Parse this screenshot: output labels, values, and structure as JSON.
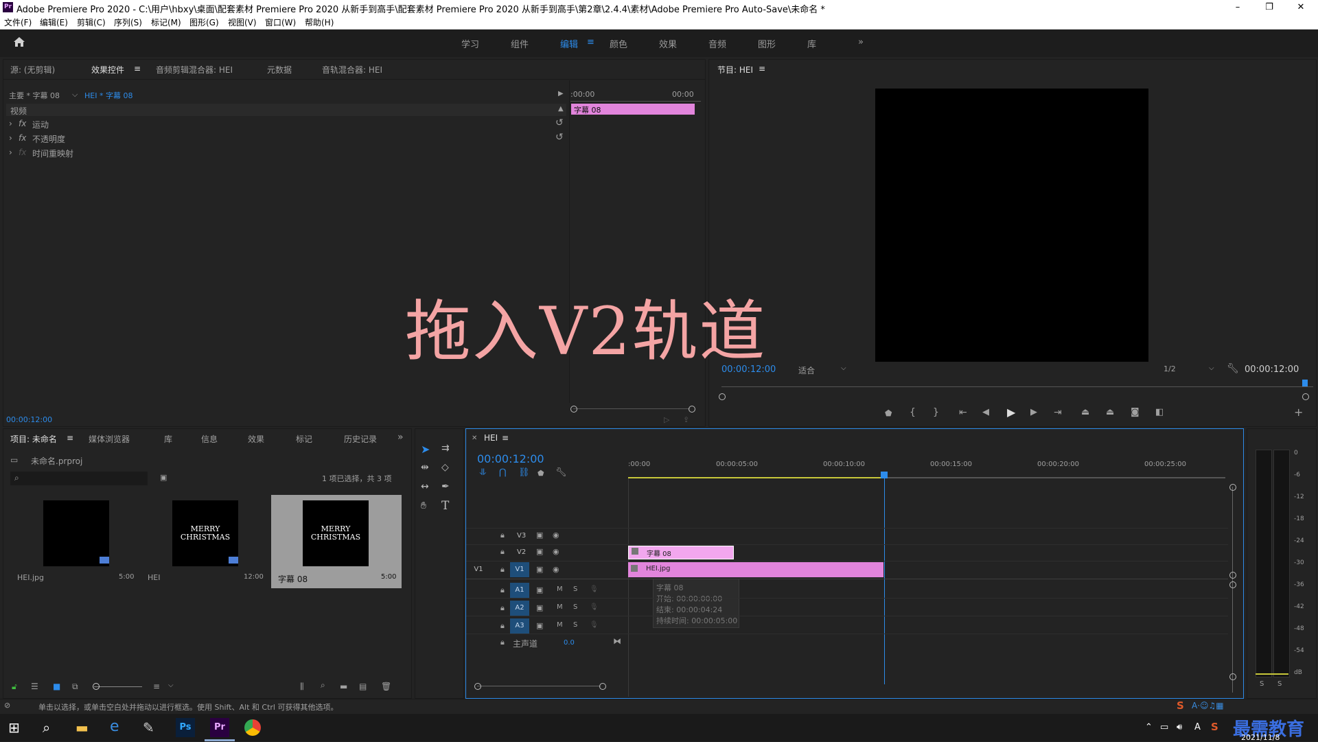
{
  "window": {
    "title": "Adobe Premiere Pro 2020 - C:\\用户\\hbxy\\桌面\\配套素材 Premiere Pro 2020 从新手到高手\\配套素材 Premiere Pro 2020 从新手到高手\\第2章\\2.4.4\\素材\\Adobe Premiere Pro Auto-Save\\未命名 *",
    "app_icon": "Pr",
    "controls": [
      "–",
      "❐",
      "✕"
    ]
  },
  "menu": [
    "文件(F)",
    "编辑(E)",
    "剪辑(C)",
    "序列(S)",
    "标记(M)",
    "图形(G)",
    "视图(V)",
    "窗口(W)",
    "帮助(H)"
  ],
  "workspaces": {
    "items": [
      "学习",
      "组件",
      "编辑",
      "颜色",
      "效果",
      "音频",
      "图形",
      "库"
    ],
    "active": "编辑",
    "more": "»"
  },
  "source_panel": {
    "tabs": [
      "源: (无剪辑)",
      "效果控件",
      "音频剪辑混合器: HEI",
      "元数据",
      "音轨混合器: HEI"
    ],
    "active_tab": "效果控件",
    "master_label": "主要 * 字幕 08",
    "clip_label": "HEI * 字幕 08",
    "ruler_start": ":00:00",
    "ruler_end": "00:00",
    "clip_bar": "字幕 08",
    "section": "视频",
    "effects": [
      {
        "fx": "fx",
        "name": "运动"
      },
      {
        "fx": "fx",
        "name": "不透明度"
      },
      {
        "fx": "fx",
        "name": "时间重映射"
      }
    ],
    "timecode": "00:00:12:00"
  },
  "program": {
    "tab": "节目: HEI",
    "timecode_left": "00:00:12:00",
    "fit": "适合",
    "quality": "1/2",
    "timecode_right": "00:00:12:00"
  },
  "project": {
    "tabs": [
      "项目: 未命名",
      "媒体浏览器",
      "库",
      "信息",
      "效果",
      "标记",
      "历史记录"
    ],
    "active_tab": "项目: 未命名",
    "file": "未命名.prproj",
    "search_placeholder": "",
    "selection_info": "1 项已选择，共 3 项",
    "items": [
      {
        "name": "HEI.jpg",
        "duration": "5:00",
        "text": ""
      },
      {
        "name": "HEI",
        "duration": "12:00",
        "text": "MERRY\nCHRISTMAS"
      },
      {
        "name": "字幕 08",
        "duration": "5:00",
        "text": "MERRY\nCHRISTMAS"
      }
    ]
  },
  "timeline": {
    "tab": "HEI",
    "timecode": "00:00:12:00",
    "ruler": [
      ":00:00",
      "00:00:05:00",
      "00:00:10:00",
      "00:00:15:00",
      "00:00:20:00",
      "00:00:25:00"
    ],
    "tracks": {
      "video": [
        "V3",
        "V2",
        "V1"
      ],
      "audio": [
        "A1",
        "A2",
        "A3"
      ],
      "master": "主声道",
      "master_value": "0.0",
      "source_v": "V1"
    },
    "clips": {
      "v2": "字幕 08",
      "v1": "HEI.jpg"
    },
    "tooltip": {
      "name": "字幕 08",
      "start": "开始: 00:00:00:00",
      "end": "结束: 00:00:04:24",
      "duration": "持续时间: 00:00:05:00"
    },
    "ms": [
      "M",
      "S"
    ]
  },
  "meter": {
    "scale": [
      "0",
      "-6",
      "-12",
      "-18",
      "-24",
      "-30",
      "-36",
      "-42",
      "-48",
      "-54",
      "dB"
    ],
    "solo": [
      "S",
      "S"
    ]
  },
  "status_bar": "单击以选择，或单击空白处并拖动以进行框选。使用 Shift、Alt 和 Ctrl 可获得其他选项。",
  "overlay_caption": "拖入V2轨道",
  "tray": {
    "brand": "最需教育",
    "date": "2021/11/8"
  },
  "colors": {
    "accent": "#2d8ceb",
    "clip_pink": "#e285dc",
    "caption": "#f4a4a4"
  }
}
